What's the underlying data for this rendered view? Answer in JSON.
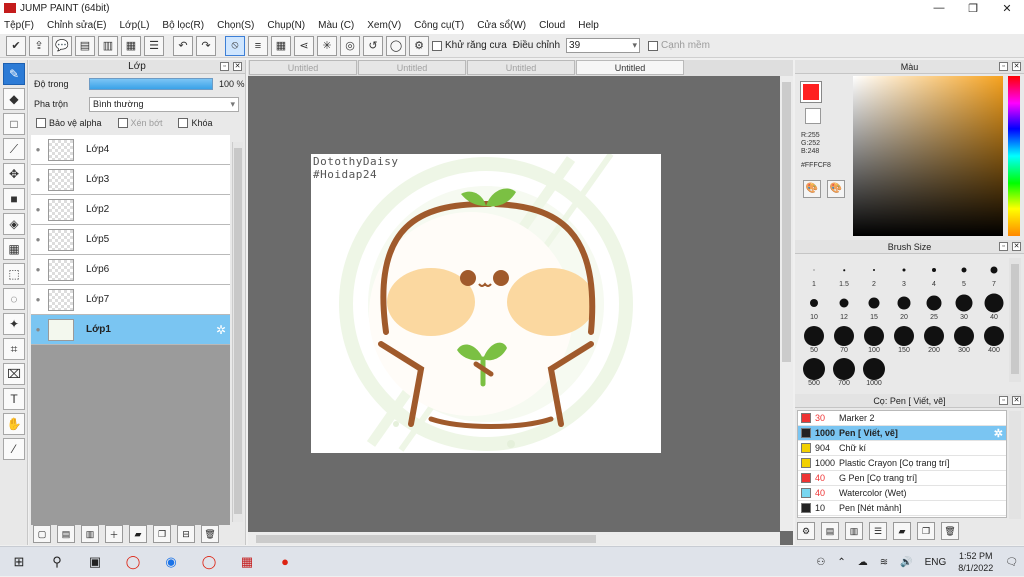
{
  "window": {
    "title": "JUMP PAINT (64bit)",
    "minimize": "—",
    "maximize": "❐",
    "close": "✕"
  },
  "menu": [
    "Tệp(F)",
    "Chỉnh sửa(E)",
    "Lớp(L)",
    "Bộ lọc(R)",
    "Chọn(S)",
    "Chụp(N)",
    "Màu (C)",
    "Xem(V)",
    "Công cụ(T)",
    "Cửa sổ(W)",
    "Cloud",
    "Help"
  ],
  "toolbar": {
    "antialias_label": "Khử răng cưa",
    "adjust_label": "Điều chỉnh",
    "adjust_value": "39",
    "edge_label": "Cạnh mềm",
    "buttons": [
      "✔",
      "⇪",
      "💬",
      "▤",
      "▥",
      "▦",
      "☰",
      "↶",
      "↷"
    ],
    "ruler_buttons": [
      "⟋",
      "≡",
      "▦",
      "⋖",
      "✳",
      "◎",
      "↺",
      "◯",
      "⚙"
    ]
  },
  "layer_panel": {
    "title": "Lớp",
    "opacity_label": "Độ trong",
    "opacity_value": "100 %",
    "opacity_fraction": 1.0,
    "blend_label": "Pha trộn",
    "blend_value": "Bình thường",
    "protect_alpha": "Bảo vệ alpha",
    "clip": "Xén bớt",
    "lock": "Khóa",
    "layers": [
      {
        "name": "Lớp4",
        "selected": false
      },
      {
        "name": "Lớp3",
        "selected": false
      },
      {
        "name": "Lớp2",
        "selected": false
      },
      {
        "name": "Lớp5",
        "selected": false
      },
      {
        "name": "Lớp6",
        "selected": false
      },
      {
        "name": "Lớp7",
        "selected": false
      },
      {
        "name": "Lớp1",
        "selected": true
      }
    ]
  },
  "canvas": {
    "tabs": [
      "Untitled",
      "Untitled",
      "Untitled",
      "Untitled"
    ],
    "active_tab_index": 3,
    "art_text_line1": "DotothyDaisy",
    "art_text_line2": "#Hoidap24"
  },
  "color_panel": {
    "title": "Màu",
    "r": "R:255",
    "g": "G:252",
    "b": "B:248",
    "hex": "#FFFCF8",
    "main_color": "#ff2020"
  },
  "brush_panel": {
    "title": "Brush Size",
    "sizes": [
      "1",
      "1.5",
      "2",
      "3",
      "4",
      "5",
      "7",
      "10",
      "12",
      "15",
      "20",
      "25",
      "30",
      "40",
      "50",
      "70",
      "100",
      "150",
      "200",
      "300",
      "400",
      "500",
      "700",
      "1000"
    ]
  },
  "sub_tool_panel": {
    "title": "Cọ: Pen [ Viết, vẽ]",
    "items": [
      {
        "size": "30",
        "name": "Marker 2",
        "color": "#ee3333",
        "red": true,
        "selected": false
      },
      {
        "size": "1000",
        "name": "Pen [ Viết, vẽ]",
        "color": "#222222",
        "red": false,
        "selected": true
      },
      {
        "size": "904",
        "name": "Chữ kí",
        "color": "#f2d000",
        "red": false,
        "selected": false
      },
      {
        "size": "1000",
        "name": "Plastic Crayon [Cọ trang trí]",
        "color": "#f2d000",
        "red": false,
        "selected": false
      },
      {
        "size": "40",
        "name": "G Pen [Cọ trang trí]",
        "color": "#ee3333",
        "red": true,
        "selected": false
      },
      {
        "size": "40",
        "name": "Watercolor (Wet)",
        "color": "#77d6f0",
        "red": true,
        "selected": false
      },
      {
        "size": "10",
        "name": "Pen [Nét mảnh]",
        "color": "#222222",
        "red": false,
        "selected": false
      }
    ]
  },
  "taskbar": {
    "ime": "ENG",
    "time": "1:52 PM",
    "date": "8/1/2022"
  }
}
